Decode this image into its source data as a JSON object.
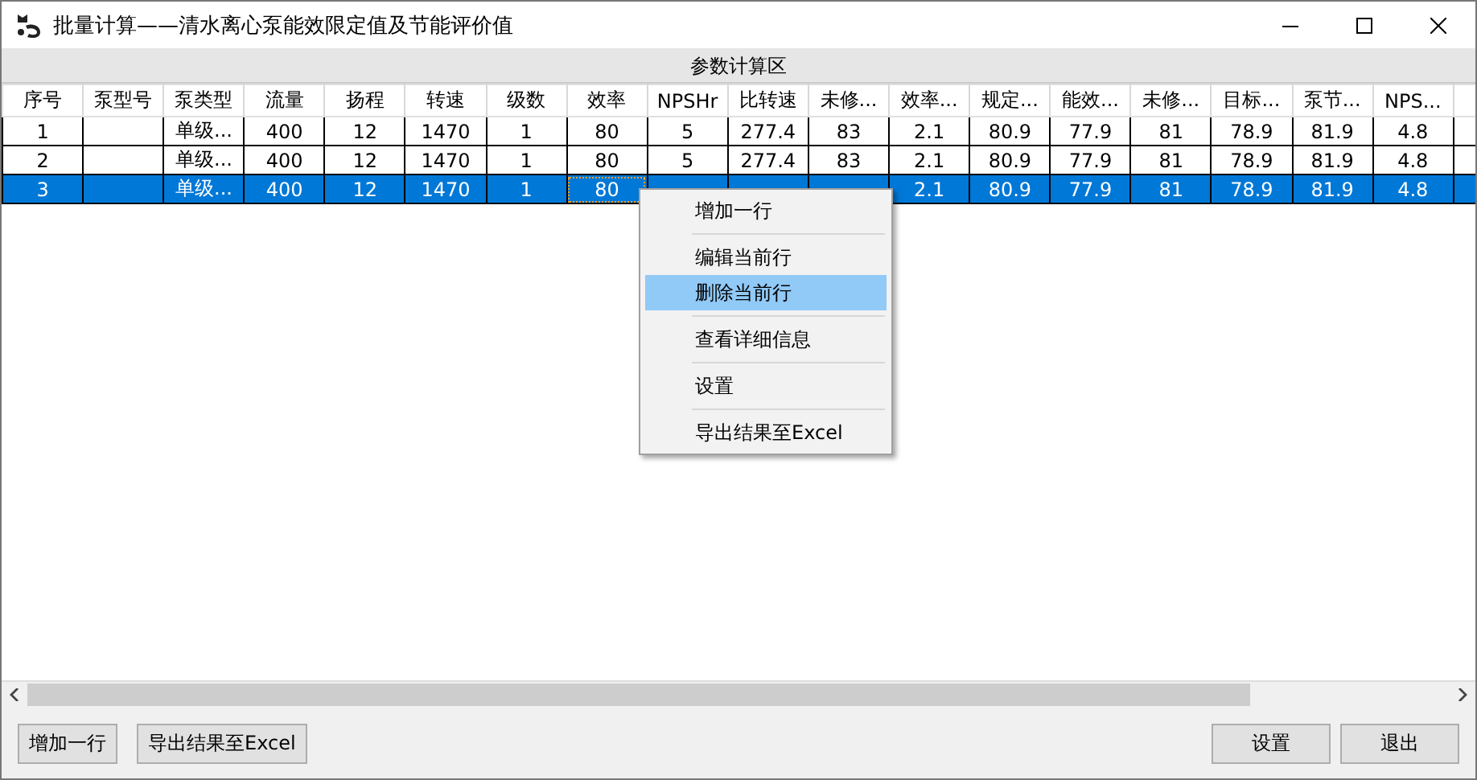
{
  "window": {
    "title": "批量计算——清水离心泵能效限定值及节能评价值"
  },
  "table": {
    "group_header": "参数计算区",
    "columns": [
      "序号",
      "泵型号",
      "泵类型",
      "流量",
      "扬程",
      "转速",
      "级数",
      "效率",
      "NPSHr",
      "比转速",
      "未修...",
      "效率...",
      "规定...",
      "能效...",
      "未修...",
      "目标...",
      "泵节...",
      "NPS..."
    ],
    "rows": [
      {
        "selected": false,
        "cells": [
          {
            "text": "1",
            "focused": false
          },
          {
            "focused": false
          },
          {
            "text": "单级...",
            "focused": false
          },
          {
            "text": "400",
            "focused": false
          },
          {
            "text": "12",
            "focused": false
          },
          {
            "text": "1470",
            "focused": false
          },
          {
            "text": "1",
            "focused": false
          },
          {
            "text": "80",
            "focused": false
          },
          {
            "text": "5",
            "focused": false
          },
          {
            "text": "277.4",
            "focused": false
          },
          {
            "text": "83",
            "focused": false
          },
          {
            "text": "2.1",
            "focused": false
          },
          {
            "text": "80.9",
            "focused": false
          },
          {
            "text": "77.9",
            "focused": false
          },
          {
            "text": "81",
            "focused": false
          },
          {
            "text": "78.9",
            "focused": false
          },
          {
            "text": "81.9",
            "focused": false
          },
          {
            "text": "4.8",
            "focused": false
          }
        ]
      },
      {
        "selected": false,
        "cells": [
          {
            "text": "2",
            "focused": false
          },
          {
            "focused": false
          },
          {
            "text": "单级...",
            "focused": false
          },
          {
            "text": "400",
            "focused": false
          },
          {
            "text": "12",
            "focused": false
          },
          {
            "text": "1470",
            "focused": false
          },
          {
            "text": "1",
            "focused": false
          },
          {
            "text": "80",
            "focused": false
          },
          {
            "text": "5",
            "focused": false
          },
          {
            "text": "277.4",
            "focused": false
          },
          {
            "text": "83",
            "focused": false
          },
          {
            "text": "2.1",
            "focused": false
          },
          {
            "text": "80.9",
            "focused": false
          },
          {
            "text": "77.9",
            "focused": false
          },
          {
            "text": "81",
            "focused": false
          },
          {
            "text": "78.9",
            "focused": false
          },
          {
            "text": "81.9",
            "focused": false
          },
          {
            "text": "4.8",
            "focused": false
          }
        ]
      },
      {
        "selected": true,
        "cells": [
          {
            "text": "3",
            "focused": false
          },
          {
            "focused": false
          },
          {
            "text": "单级...",
            "focused": false
          },
          {
            "text": "400",
            "focused": false
          },
          {
            "text": "12",
            "focused": false
          },
          {
            "text": "1470",
            "focused": false
          },
          {
            "text": "1",
            "focused": false
          },
          {
            "text": "80",
            "focused": true
          },
          {
            "focused": false
          },
          {
            "focused": false
          },
          {
            "focused": false
          },
          {
            "text": "2.1",
            "focused": false
          },
          {
            "text": "80.9",
            "focused": false
          },
          {
            "text": "77.9",
            "focused": false
          },
          {
            "text": "81",
            "focused": false
          },
          {
            "text": "78.9",
            "focused": false
          },
          {
            "text": "81.9",
            "focused": false
          },
          {
            "text": "4.8",
            "focused": false
          }
        ]
      }
    ]
  },
  "context_menu": [
    {
      "kind": "item",
      "label": "增加一行",
      "selected": false
    },
    {
      "kind": "separator"
    },
    {
      "kind": "item",
      "label": "编辑当前行",
      "selected": false
    },
    {
      "kind": "item",
      "label": "删除当前行",
      "selected": true
    },
    {
      "kind": "separator"
    },
    {
      "kind": "item",
      "label": "查看详细信息",
      "selected": false
    },
    {
      "kind": "separator"
    },
    {
      "kind": "item",
      "label": "设置",
      "selected": false
    },
    {
      "kind": "separator"
    },
    {
      "kind": "item",
      "label": "导出结果至Excel",
      "selected": false
    }
  ],
  "buttons_left": [
    "增加一行",
    "导出结果至Excel"
  ],
  "buttons_right": [
    "设置",
    "退出"
  ]
}
